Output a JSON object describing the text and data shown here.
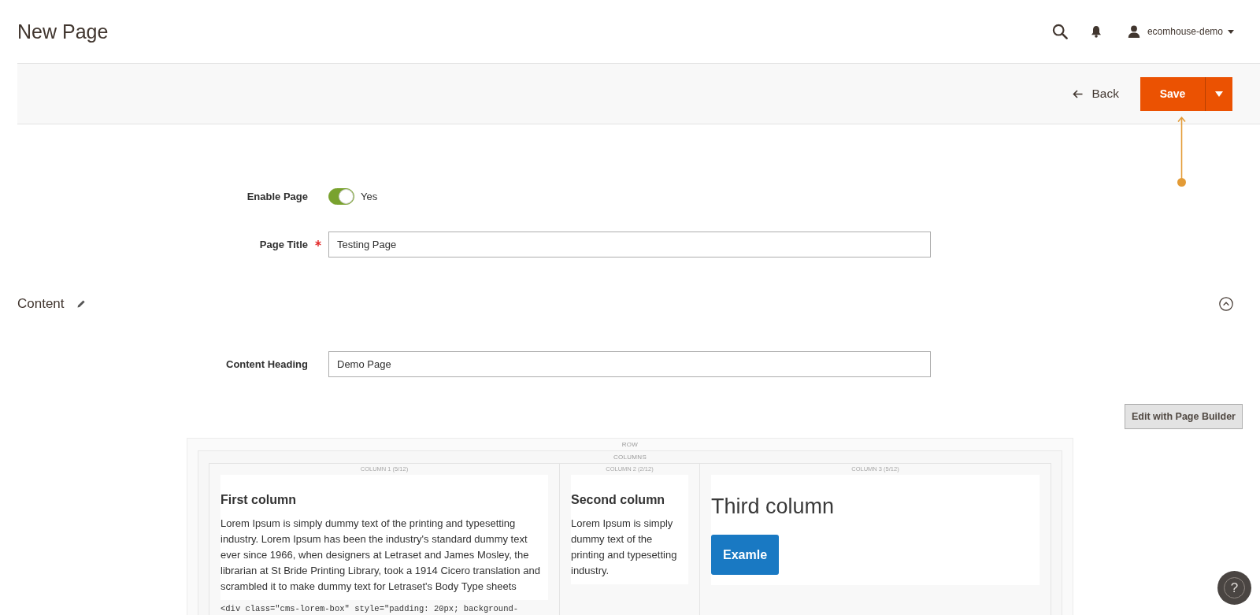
{
  "header": {
    "title": "New Page",
    "user": {
      "name": "ecomhouse-demo"
    }
  },
  "actions": {
    "back": "Back",
    "save": "Save"
  },
  "form": {
    "fields": [
      {
        "kind": "toggle",
        "label": "Enable Page",
        "on": true,
        "value": "Yes"
      },
      {
        "kind": "text",
        "label": "Page Title",
        "required": true,
        "value": "Testing Page"
      }
    ]
  },
  "content_section": {
    "title": "Content",
    "expanded": true,
    "fields": [
      {
        "kind": "text",
        "label": "Content Heading",
        "value": "Demo Page"
      }
    ],
    "edit_button": "Edit with Page Builder",
    "stage": {
      "row_label": "ROW",
      "columns_label": "COLUMNS",
      "columns": [
        {
          "label": "COLUMN 1 (5/12)",
          "blocks": [
            {
              "kind": "heading",
              "text": "First column"
            },
            {
              "kind": "text",
              "text": "Lorem Ipsum is simply dummy text of the printing and typesetting industry. Lorem Ipsum has been the industry's standard dummy text ever since 1966, when designers at Letraset and James Mosley, the librarian at St Bride Printing Library, took a 1914 Cicero translation and scrambled it to make dummy text for Letraset's Body Type sheets"
            }
          ],
          "code": "<div class=\"cms-lorem-box\" style=\"padding: 20px; background-"
        },
        {
          "label": "COLUMN 2 (2/12)",
          "blocks": [
            {
              "kind": "heading",
              "text": "Second column"
            },
            {
              "kind": "text",
              "text": "Lorem Ipsum is simply dummy text of the printing and typesetting industry."
            }
          ]
        },
        {
          "label": "COLUMN 3 (5/12)",
          "blocks": [
            {
              "kind": "title",
              "text": "Third column"
            },
            {
              "kind": "button",
              "text": "Examle"
            }
          ]
        }
      ]
    }
  },
  "help": {
    "label": "?"
  }
}
